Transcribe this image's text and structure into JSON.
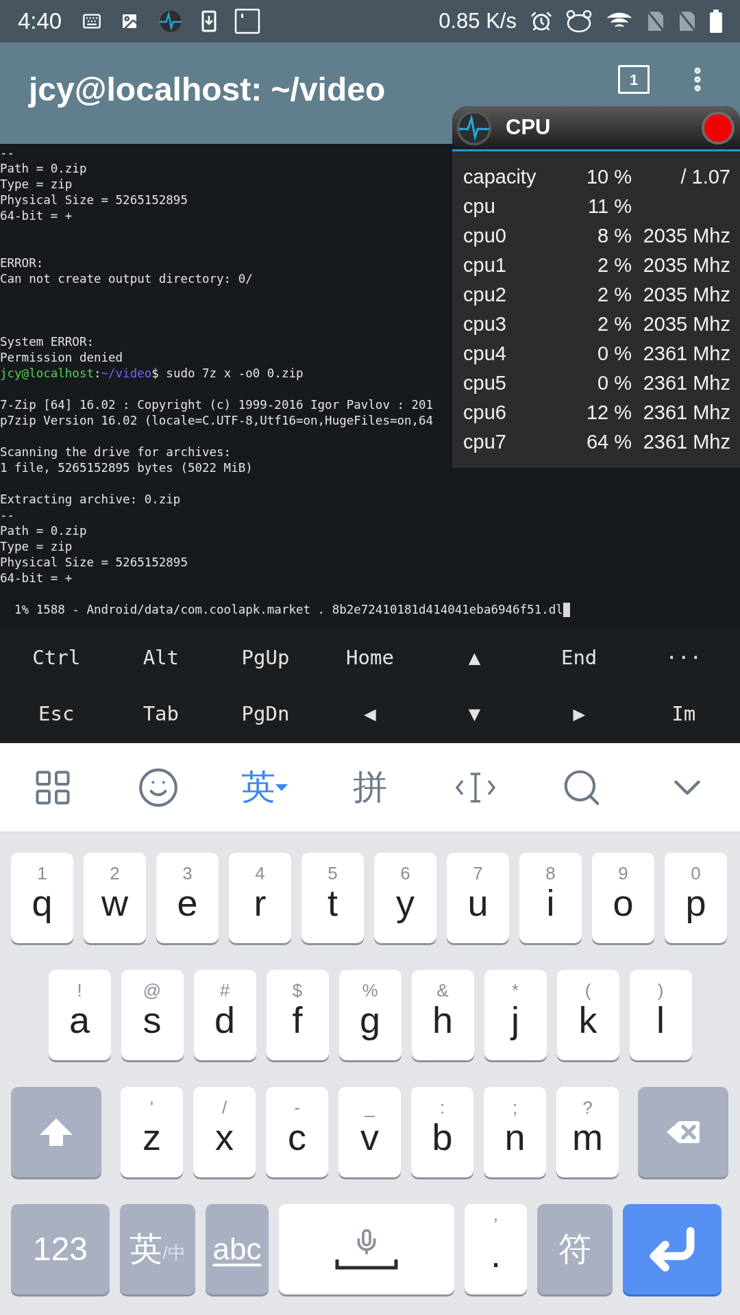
{
  "status_bar": {
    "time": "4:40",
    "speed": "0.85 K/s"
  },
  "title_bar": {
    "title": "jcy@localhost: ~/video",
    "tab_count": "1"
  },
  "terminal": {
    "lines": [
      {
        "kind": "output",
        "text": "--"
      },
      {
        "kind": "output",
        "text": "Path = 0.zip"
      },
      {
        "kind": "output",
        "text": "Type = zip"
      },
      {
        "kind": "output",
        "text": "Physical Size = 5265152895"
      },
      {
        "kind": "output",
        "text": "64-bit = +"
      },
      {
        "kind": "blank"
      },
      {
        "kind": "blank"
      },
      {
        "kind": "output",
        "text": "ERROR:"
      },
      {
        "kind": "output",
        "text": "Can not create output directory: 0/"
      },
      {
        "kind": "blank"
      },
      {
        "kind": "blank"
      },
      {
        "kind": "blank"
      },
      {
        "kind": "output",
        "text": "System ERROR:"
      },
      {
        "kind": "output",
        "text": "Permission denied"
      },
      {
        "kind": "prompt",
        "segments": [
          {
            "text": "jcy@localhost",
            "color": "#4fd14f"
          },
          {
            "text": ":",
            "color": "#e4e4e4"
          },
          {
            "text": "~/video",
            "color": "#6a6af2"
          },
          {
            "text": "$ sudo 7z x -o0 0.zip",
            "color": "#e4e4e4"
          }
        ]
      },
      {
        "kind": "blank"
      },
      {
        "kind": "output",
        "text": "7-Zip [64] 16.02 : Copyright (c) 1999-2016 Igor Pavlov : 201"
      },
      {
        "kind": "output",
        "text": "p7zip Version 16.02 (locale=C.UTF-8,Utf16=on,HugeFiles=on,64"
      },
      {
        "kind": "blank"
      },
      {
        "kind": "output",
        "text": "Scanning the drive for archives:"
      },
      {
        "kind": "output",
        "text": "1 file, 5265152895 bytes (5022 MiB)"
      },
      {
        "kind": "blank"
      },
      {
        "kind": "output",
        "text": "Extracting archive: 0.zip"
      },
      {
        "kind": "output",
        "text": "--"
      },
      {
        "kind": "output",
        "text": "Path = 0.zip"
      },
      {
        "kind": "output",
        "text": "Type = zip"
      },
      {
        "kind": "output",
        "text": "Physical Size = 5265152895"
      },
      {
        "kind": "output",
        "text": "64-bit = +"
      },
      {
        "kind": "blank"
      },
      {
        "kind": "progress",
        "text": "  1% 1588 - Android/data/com.coolapk.market . 8b2e72410181d414041eba6946f51.dl"
      }
    ]
  },
  "cpu_monitor": {
    "title": "CPU",
    "rows": [
      {
        "name": "capacity",
        "percent": "10 %",
        "value": "/ 1.07"
      },
      {
        "name": "cpu",
        "percent": "11 %"
      },
      {
        "name": "cpu0",
        "percent": "8 %",
        "value": "2035 Mhz"
      },
      {
        "name": "cpu1",
        "percent": "2 %",
        "value": "2035 Mhz"
      },
      {
        "name": "cpu2",
        "percent": "2 %",
        "value": "2035 Mhz"
      },
      {
        "name": "cpu3",
        "percent": "2 %",
        "value": "2035 Mhz"
      },
      {
        "name": "cpu4",
        "percent": "0 %",
        "value": "2361 Mhz"
      },
      {
        "name": "cpu5",
        "percent": "0 %",
        "value": "2361 Mhz"
      },
      {
        "name": "cpu6",
        "percent": "12 %",
        "value": "2361 Mhz"
      },
      {
        "name": "cpu7",
        "percent": "64 %",
        "value": "2361 Mhz"
      }
    ]
  },
  "extra_keys": [
    [
      "Ctrl",
      "Alt",
      "PgUp",
      "Home",
      "▲",
      "End",
      "···"
    ],
    [
      "Esc",
      "Tab",
      "PgDn",
      "◀",
      "▼",
      "▶",
      "Im"
    ]
  ],
  "ime_toolbar": {
    "language": {
      "label": "英",
      "selected": true
    },
    "pinyin": {
      "label": "拼",
      "selected": false
    }
  },
  "keyboard": {
    "rows": [
      [
        {
          "kind": "letter",
          "label": "q",
          "hint": "1"
        },
        {
          "kind": "letter",
          "label": "w",
          "hint": "2"
        },
        {
          "kind": "letter",
          "label": "e",
          "hint": "3"
        },
        {
          "kind": "letter",
          "label": "r",
          "hint": "4"
        },
        {
          "kind": "letter",
          "label": "t",
          "hint": "5"
        },
        {
          "kind": "letter",
          "label": "y",
          "hint": "6"
        },
        {
          "kind": "letter",
          "label": "u",
          "hint": "7"
        },
        {
          "kind": "letter",
          "label": "i",
          "hint": "8"
        },
        {
          "kind": "letter",
          "label": "o",
          "hint": "9"
        },
        {
          "kind": "letter",
          "label": "p",
          "hint": "0"
        }
      ],
      [
        {
          "kind": "letter",
          "label": "a",
          "hint": "!"
        },
        {
          "kind": "letter",
          "label": "s",
          "hint": "@"
        },
        {
          "kind": "letter",
          "label": "d",
          "hint": "#"
        },
        {
          "kind": "letter",
          "label": "f",
          "hint": "$"
        },
        {
          "kind": "letter",
          "label": "g",
          "hint": "%"
        },
        {
          "kind": "letter",
          "label": "h",
          "hint": "&"
        },
        {
          "kind": "letter",
          "label": "j",
          "hint": "*"
        },
        {
          "kind": "letter",
          "label": "k",
          "hint": "("
        },
        {
          "kind": "letter",
          "label": "l",
          "hint": ")"
        }
      ],
      [
        {
          "kind": "shift"
        },
        {
          "kind": "letter",
          "label": "z",
          "hint": "'"
        },
        {
          "kind": "letter",
          "label": "x",
          "hint": "/"
        },
        {
          "kind": "letter",
          "label": "c",
          "hint": "-"
        },
        {
          "kind": "letter",
          "label": "v",
          "hint": "_"
        },
        {
          "kind": "letter",
          "label": "b",
          "hint": ":"
        },
        {
          "kind": "letter",
          "label": "n",
          "hint": ";"
        },
        {
          "kind": "letter",
          "label": "m",
          "hint": "?"
        },
        {
          "kind": "backspace"
        }
      ],
      [
        {
          "kind": "function",
          "label": "123"
        },
        {
          "kind": "language",
          "label": "英",
          "sub": "/中"
        },
        {
          "kind": "abc",
          "label": "abc"
        },
        {
          "kind": "space"
        },
        {
          "kind": "letter",
          "label": ".",
          "hint": "’"
        },
        {
          "kind": "function",
          "label": "符"
        },
        {
          "kind": "enter"
        }
      ]
    ]
  }
}
